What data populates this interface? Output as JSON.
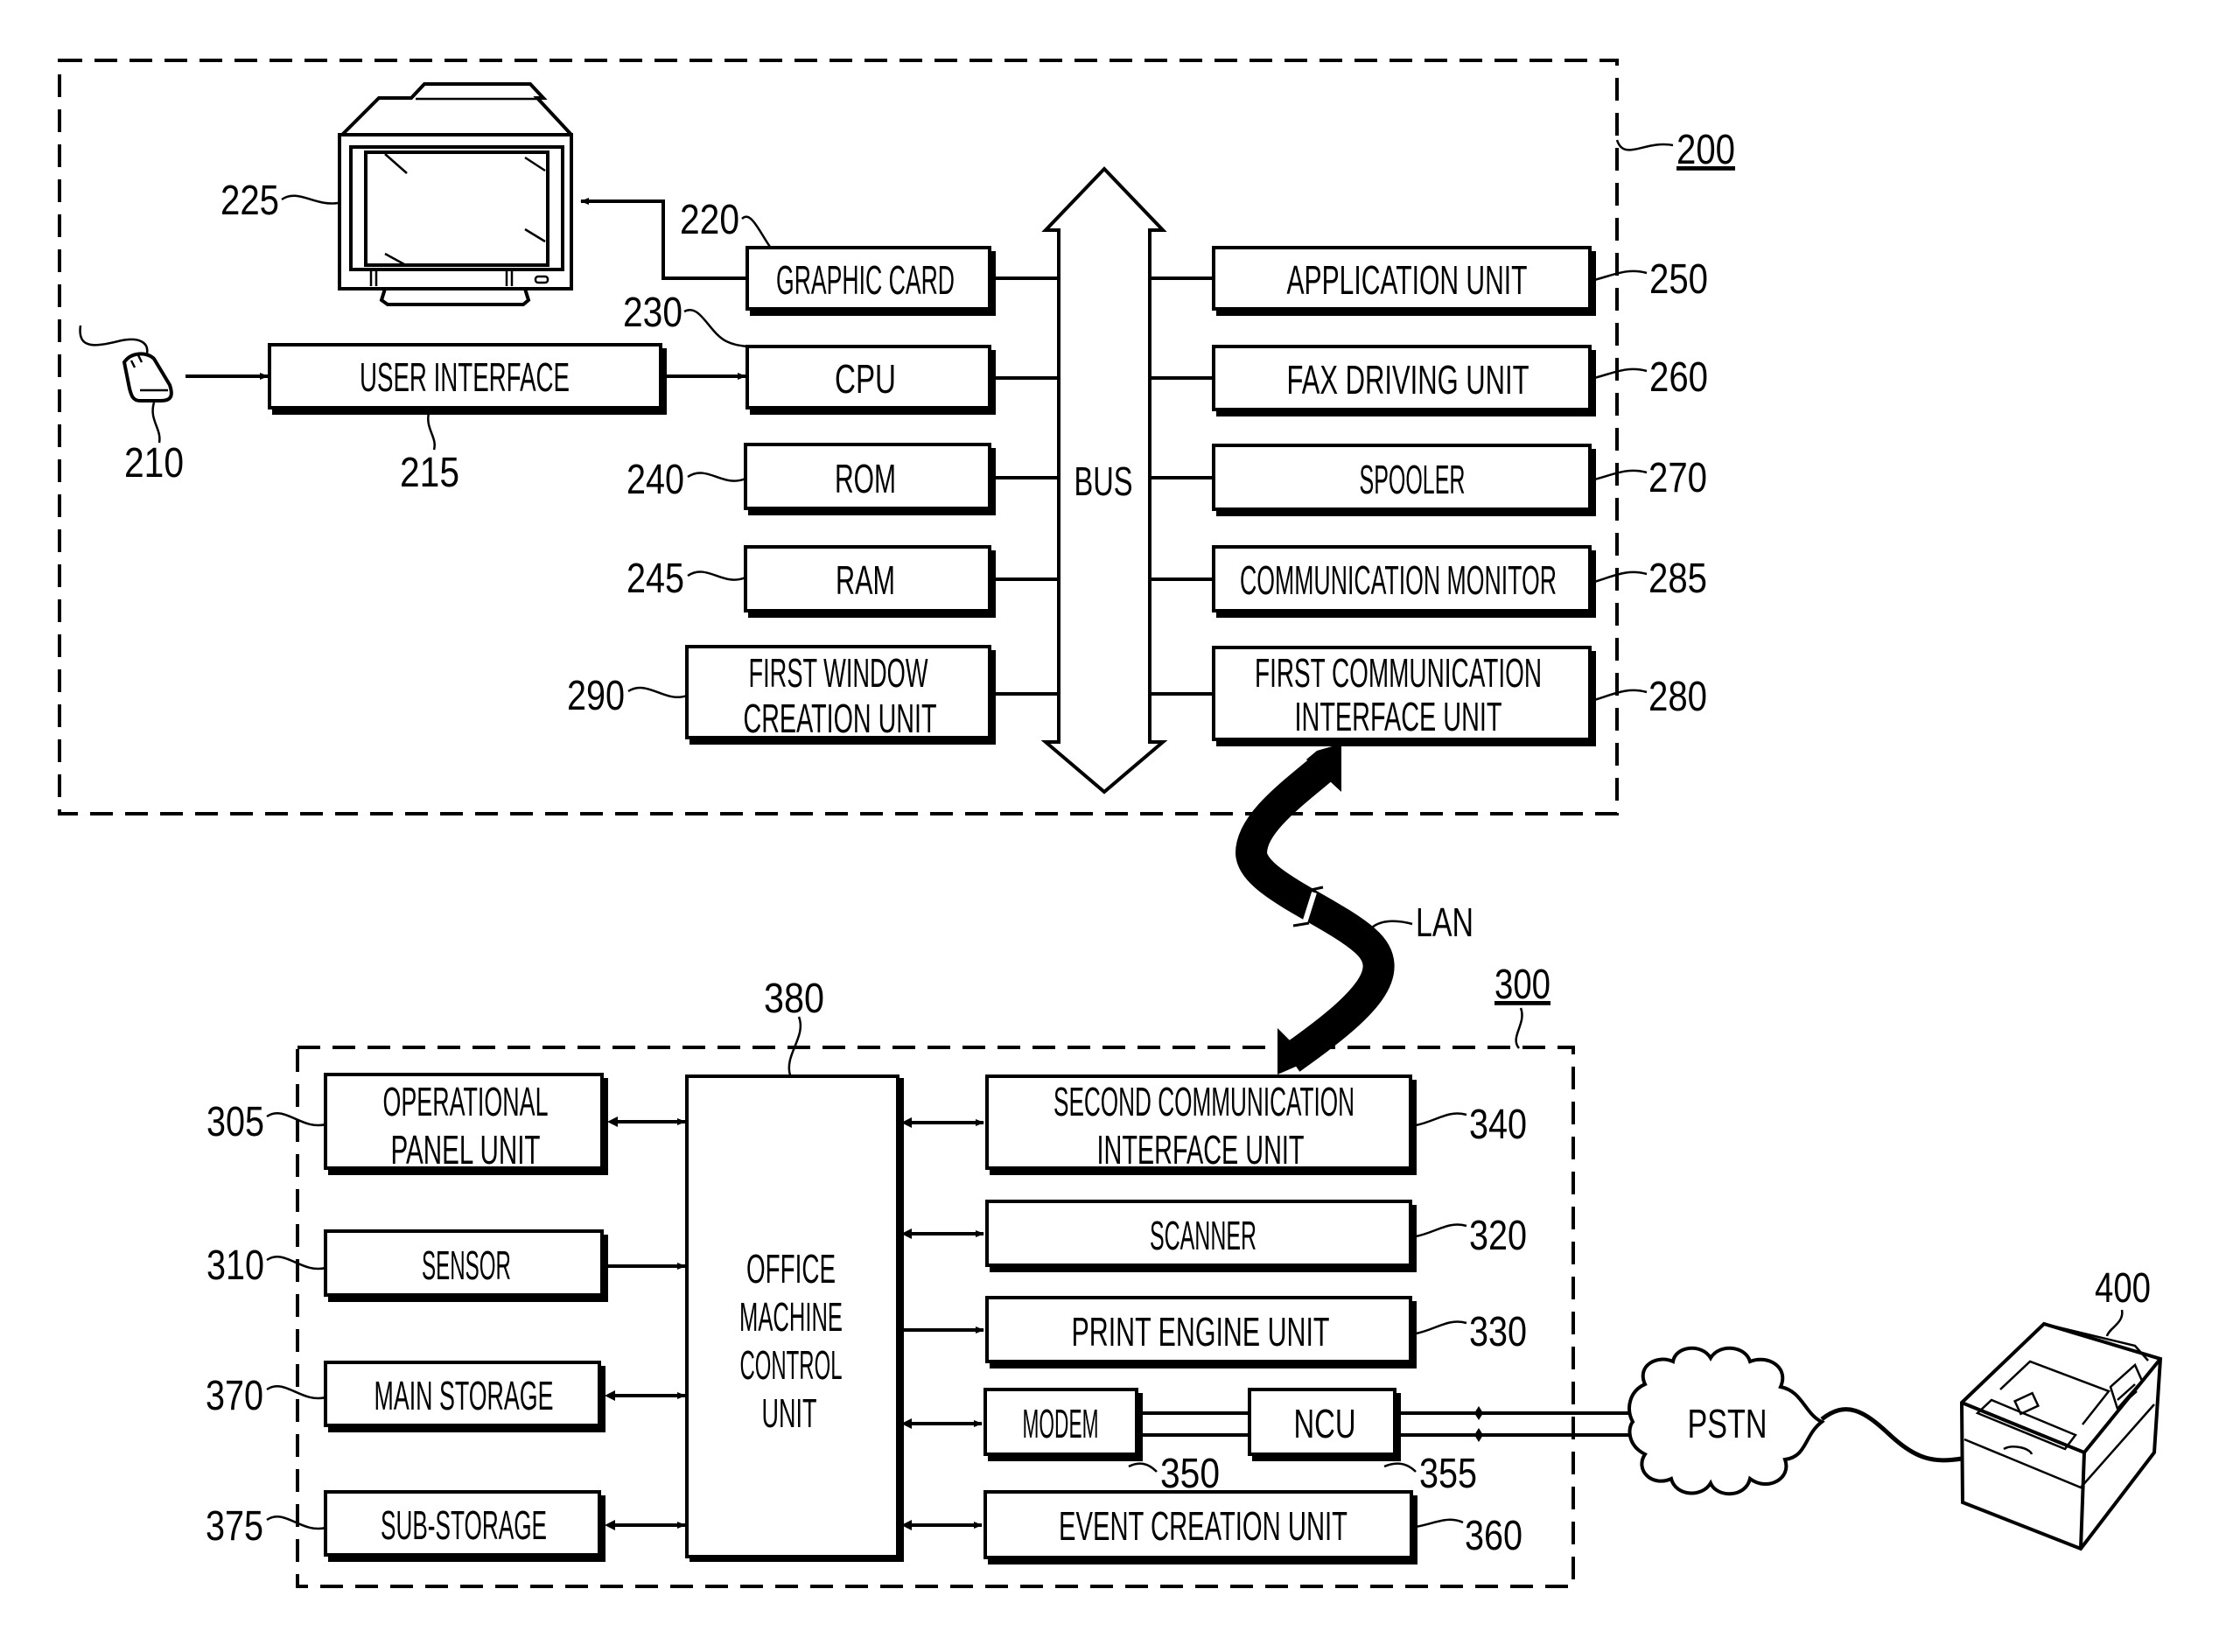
{
  "figure": {
    "system_200": {
      "ref": "200",
      "blocks": {
        "graphic_card": {
          "label": "GRAPHIC CARD",
          "ref": "220"
        },
        "cpu": {
          "label": "CPU",
          "ref": "230"
        },
        "rom": {
          "label": "ROM",
          "ref": "240"
        },
        "ram": {
          "label": "RAM",
          "ref": "245"
        },
        "first_window_creation_unit": {
          "lines": [
            "FIRST WINDOW",
            "CREATION UNIT"
          ],
          "ref": "290"
        },
        "user_interface": {
          "label": "USER INTERFACE",
          "ref": "215"
        },
        "application_unit": {
          "label": "APPLICATION UNIT",
          "ref": "250"
        },
        "fax_driving_unit": {
          "label": "FAX DRIVING UNIT",
          "ref": "260"
        },
        "spooler": {
          "label": "SPOOLER",
          "ref": "270"
        },
        "communication_monitor": {
          "label": "COMMUNICATION MONITOR",
          "ref": "285"
        },
        "first_communication_interface_unit": {
          "lines": [
            "FIRST COMMUNICATION",
            "INTERFACE UNIT"
          ],
          "ref": "280"
        }
      },
      "bus": {
        "label": "BUS"
      },
      "mouse": {
        "ref": "210"
      },
      "monitor": {
        "ref": "225"
      }
    },
    "network": {
      "label": "LAN"
    },
    "system_300": {
      "ref": "300",
      "blocks": {
        "operational_panel_unit": {
          "lines": [
            "OPERATIONAL",
            "PANEL UNIT"
          ],
          "ref": "305"
        },
        "sensor": {
          "label": "SENSOR",
          "ref": "310"
        },
        "main_storage": {
          "label": "MAIN STORAGE",
          "ref": "370"
        },
        "sub_storage": {
          "label": "SUB-STORAGE",
          "ref": "375"
        },
        "office_machine_control_unit": {
          "lines": [
            "OFFICE",
            "MACHINE",
            "CONTROL",
            "UNIT"
          ],
          "ref": "380"
        },
        "second_communication_interface_unit": {
          "lines": [
            "SECOND COMMUNICATION",
            "INTERFACE UNIT"
          ],
          "ref": "340"
        },
        "scanner": {
          "label": "SCANNER",
          "ref": "320"
        },
        "print_engine_unit": {
          "label": "PRINT ENGINE UNIT",
          "ref": "330"
        },
        "modem": {
          "label": "MODEM",
          "ref": "350"
        },
        "ncu": {
          "label": "NCU",
          "ref": "355"
        },
        "event_creation_unit": {
          "label": "EVENT CREATION UNIT",
          "ref": "360"
        }
      }
    },
    "pstn": {
      "label": "PSTN"
    },
    "fax_machine": {
      "ref": "400"
    }
  }
}
